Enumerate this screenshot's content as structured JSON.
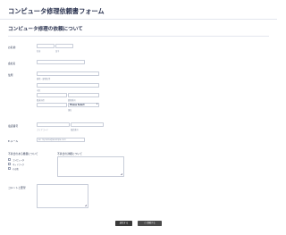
{
  "form": {
    "title": "コンピュータ修理依頼書フォーム",
    "section_title": "コンピュータ修理の依頼について"
  },
  "fields": {
    "name": {
      "label": "お名前",
      "first_sub": "名前",
      "last_sub": "苗字"
    },
    "company": {
      "label": "会社名"
    },
    "address": {
      "label": "住所",
      "street_sub": "番地・建物名等",
      "city_sub": "市区",
      "prefecture_sub": "都道府県",
      "postal_sub": "郵便番号",
      "country_value": "Please Select",
      "country_sub": "国名"
    },
    "phone": {
      "label": "電話番号",
      "area_sub": "エリアコード",
      "number_sub": "電話番号"
    },
    "email": {
      "label": "E-メール",
      "placeholder": "ex: myname@example.com"
    },
    "device": {
      "label": "不具合のある機器について",
      "options": [
        "コンピュータ",
        "ネットワーク",
        "その他"
      ]
    },
    "issue": {
      "label": "不具合の詳細について"
    },
    "comments": {
      "label": "コメントと要望"
    }
  },
  "buttons": {
    "submit": "送信する",
    "print": "印刷する"
  }
}
